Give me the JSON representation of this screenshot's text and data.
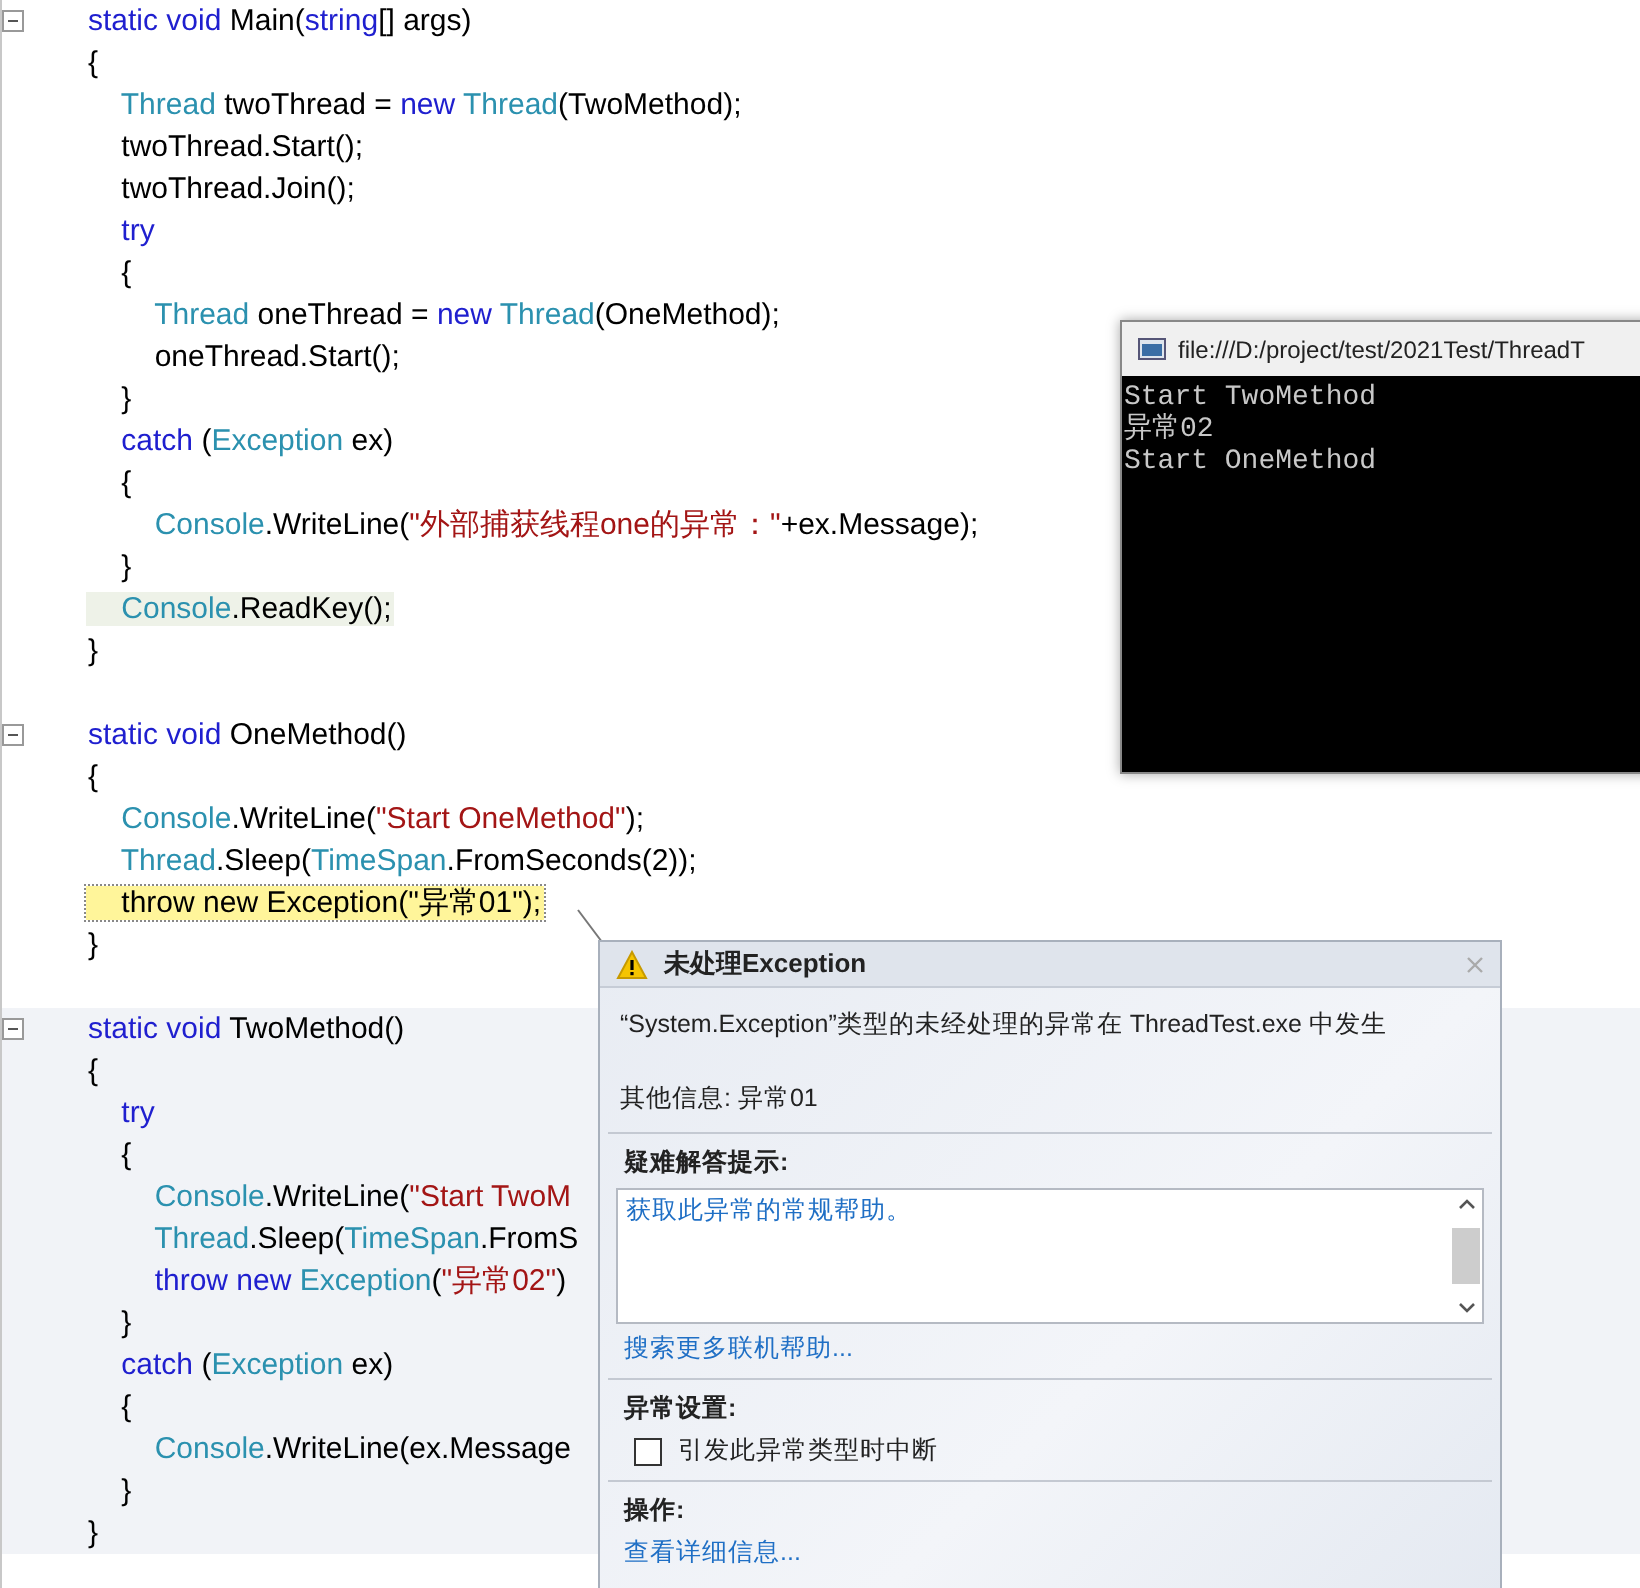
{
  "editor": {
    "methods": [
      {
        "shaded": false,
        "lines": [
          {
            "current": false,
            "referenced": false,
            "tokens": [
              {
                "kind": "keyword",
                "text": "static void "
              },
              {
                "kind": "plain",
                "text": "Main("
              },
              {
                "kind": "keyword",
                "text": "string"
              },
              {
                "kind": "plain",
                "text": "[] args)"
              }
            ]
          },
          {
            "current": false,
            "referenced": false,
            "tokens": [
              {
                "kind": "plain",
                "text": "{"
              }
            ]
          },
          {
            "current": false,
            "referenced": false,
            "tokens": [
              {
                "kind": "type",
                "text": "    Thread"
              },
              {
                "kind": "plain",
                "text": " twoThread = "
              },
              {
                "kind": "keyword",
                "text": "new "
              },
              {
                "kind": "type",
                "text": "Thread"
              },
              {
                "kind": "plain",
                "text": "(TwoMethod);"
              }
            ]
          },
          {
            "current": false,
            "referenced": false,
            "tokens": [
              {
                "kind": "plain",
                "text": "    twoThread.Start();"
              }
            ]
          },
          {
            "current": false,
            "referenced": false,
            "tokens": [
              {
                "kind": "plain",
                "text": "    twoThread.Join();"
              }
            ]
          },
          {
            "current": false,
            "referenced": false,
            "tokens": [
              {
                "kind": "keyword",
                "text": "    try"
              }
            ]
          },
          {
            "current": false,
            "referenced": false,
            "tokens": [
              {
                "kind": "plain",
                "text": "    {"
              }
            ]
          },
          {
            "current": false,
            "referenced": false,
            "tokens": [
              {
                "kind": "type",
                "text": "        Thread"
              },
              {
                "kind": "plain",
                "text": " oneThread = "
              },
              {
                "kind": "keyword",
                "text": "new "
              },
              {
                "kind": "type",
                "text": "Thread"
              },
              {
                "kind": "plain",
                "text": "(OneMethod);"
              }
            ]
          },
          {
            "current": false,
            "referenced": false,
            "tokens": [
              {
                "kind": "plain",
                "text": "        oneThread.Start();"
              }
            ]
          },
          {
            "current": false,
            "referenced": false,
            "tokens": [
              {
                "kind": "plain",
                "text": "    }"
              }
            ]
          },
          {
            "current": false,
            "referenced": false,
            "tokens": [
              {
                "kind": "keyword",
                "text": "    catch"
              },
              {
                "kind": "plain",
                "text": " ("
              },
              {
                "kind": "type",
                "text": "Exception"
              },
              {
                "kind": "plain",
                "text": " ex)"
              }
            ]
          },
          {
            "current": false,
            "referenced": false,
            "tokens": [
              {
                "kind": "plain",
                "text": "    {"
              }
            ]
          },
          {
            "current": false,
            "referenced": false,
            "tokens": [
              {
                "kind": "type",
                "text": "        Console"
              },
              {
                "kind": "plain",
                "text": ".WriteLine("
              },
              {
                "kind": "string",
                "text": "\"外部捕获线程one的异常：\""
              },
              {
                "kind": "plain",
                "text": "+ex.Message);"
              }
            ]
          },
          {
            "current": false,
            "referenced": false,
            "tokens": [
              {
                "kind": "plain",
                "text": "    }"
              }
            ]
          },
          {
            "current": false,
            "referenced": true,
            "tokens": [
              {
                "kind": "type",
                "text": "    Console"
              },
              {
                "kind": "plain",
                "text": ".ReadKey();"
              }
            ]
          },
          {
            "current": false,
            "referenced": false,
            "tokens": [
              {
                "kind": "plain",
                "text": "}"
              }
            ]
          }
        ]
      },
      {
        "shaded": false,
        "lines": [
          {
            "current": false,
            "referenced": false,
            "tokens": [
              {
                "kind": "keyword",
                "text": "static void "
              },
              {
                "kind": "plain",
                "text": "OneMethod()"
              }
            ]
          },
          {
            "current": false,
            "referenced": false,
            "tokens": [
              {
                "kind": "plain",
                "text": "{"
              }
            ]
          },
          {
            "current": false,
            "referenced": false,
            "tokens": [
              {
                "kind": "type",
                "text": "    Console"
              },
              {
                "kind": "plain",
                "text": ".WriteLine("
              },
              {
                "kind": "string",
                "text": "\"Start OneMethod\""
              },
              {
                "kind": "plain",
                "text": ");"
              }
            ]
          },
          {
            "current": false,
            "referenced": false,
            "tokens": [
              {
                "kind": "type",
                "text": "    Thread"
              },
              {
                "kind": "plain",
                "text": ".Sleep("
              },
              {
                "kind": "type",
                "text": "TimeSpan"
              },
              {
                "kind": "plain",
                "text": ".FromSeconds(2));"
              }
            ]
          },
          {
            "current": true,
            "referenced": false,
            "tokens": [
              {
                "kind": "plain",
                "text": "    throw new Exception(\"异常01\");"
              }
            ]
          },
          {
            "current": false,
            "referenced": false,
            "tokens": [
              {
                "kind": "plain",
                "text": "}"
              }
            ]
          }
        ]
      },
      {
        "shaded": true,
        "lines": [
          {
            "current": false,
            "referenced": false,
            "tokens": [
              {
                "kind": "keyword",
                "text": "static void "
              },
              {
                "kind": "plain",
                "text": "TwoMethod()"
              }
            ]
          },
          {
            "current": false,
            "referenced": false,
            "tokens": [
              {
                "kind": "plain",
                "text": "{"
              }
            ]
          },
          {
            "current": false,
            "referenced": false,
            "tokens": [
              {
                "kind": "keyword",
                "text": "    try"
              }
            ]
          },
          {
            "current": false,
            "referenced": false,
            "tokens": [
              {
                "kind": "plain",
                "text": "    {"
              }
            ]
          },
          {
            "current": false,
            "referenced": false,
            "tokens": [
              {
                "kind": "type",
                "text": "        Console"
              },
              {
                "kind": "plain",
                "text": ".WriteLine("
              },
              {
                "kind": "string",
                "text": "\"Start TwoM"
              }
            ]
          },
          {
            "current": false,
            "referenced": false,
            "tokens": [
              {
                "kind": "type",
                "text": "        Thread"
              },
              {
                "kind": "plain",
                "text": ".Sleep("
              },
              {
                "kind": "type",
                "text": "TimeSpan"
              },
              {
                "kind": "plain",
                "text": ".FromS"
              }
            ]
          },
          {
            "current": false,
            "referenced": false,
            "tokens": [
              {
                "kind": "keyword",
                "text": "        throw new "
              },
              {
                "kind": "type",
                "text": "Exception"
              },
              {
                "kind": "plain",
                "text": "("
              },
              {
                "kind": "string",
                "text": "\"异常02\""
              },
              {
                "kind": "plain",
                "text": ")"
              }
            ]
          },
          {
            "current": false,
            "referenced": false,
            "tokens": [
              {
                "kind": "plain",
                "text": "    }"
              }
            ]
          },
          {
            "current": false,
            "referenced": false,
            "tokens": [
              {
                "kind": "keyword",
                "text": "    catch"
              },
              {
                "kind": "plain",
                "text": " ("
              },
              {
                "kind": "type",
                "text": "Exception"
              },
              {
                "kind": "plain",
                "text": " ex)"
              }
            ]
          },
          {
            "current": false,
            "referenced": false,
            "tokens": [
              {
                "kind": "plain",
                "text": "    {"
              }
            ]
          },
          {
            "current": false,
            "referenced": false,
            "tokens": [
              {
                "kind": "type",
                "text": "        Console"
              },
              {
                "kind": "plain",
                "text": ".WriteLine(ex.Message"
              }
            ]
          },
          {
            "current": false,
            "referenced": false,
            "tokens": [
              {
                "kind": "plain",
                "text": "    }"
              }
            ]
          },
          {
            "current": false,
            "referenced": false,
            "tokens": [
              {
                "kind": "plain",
                "text": "}"
              }
            ]
          }
        ]
      }
    ]
  },
  "console_window": {
    "title": "file:///D:/project/test/2021Test/ThreadT",
    "output": [
      "Start TwoMethod",
      "异常02",
      "Start OneMethod"
    ]
  },
  "exception_dialog": {
    "title": "未处理Exception",
    "message": "“System.Exception”类型的未经处理的异常在 ThreadTest.exe 中发生",
    "additional_info": "其他信息: 异常01",
    "troubleshooting": {
      "heading": "疑难解答提示:",
      "tips": [
        "获取此异常的常规帮助。"
      ],
      "link": "搜索更多联机帮助..."
    },
    "settings": {
      "heading": "异常设置:",
      "options": [
        {
          "label": "引发此异常类型时中断",
          "checked": false
        }
      ]
    },
    "actions": {
      "heading": "操作:",
      "links": [
        "查看详细信息..."
      ]
    }
  }
}
